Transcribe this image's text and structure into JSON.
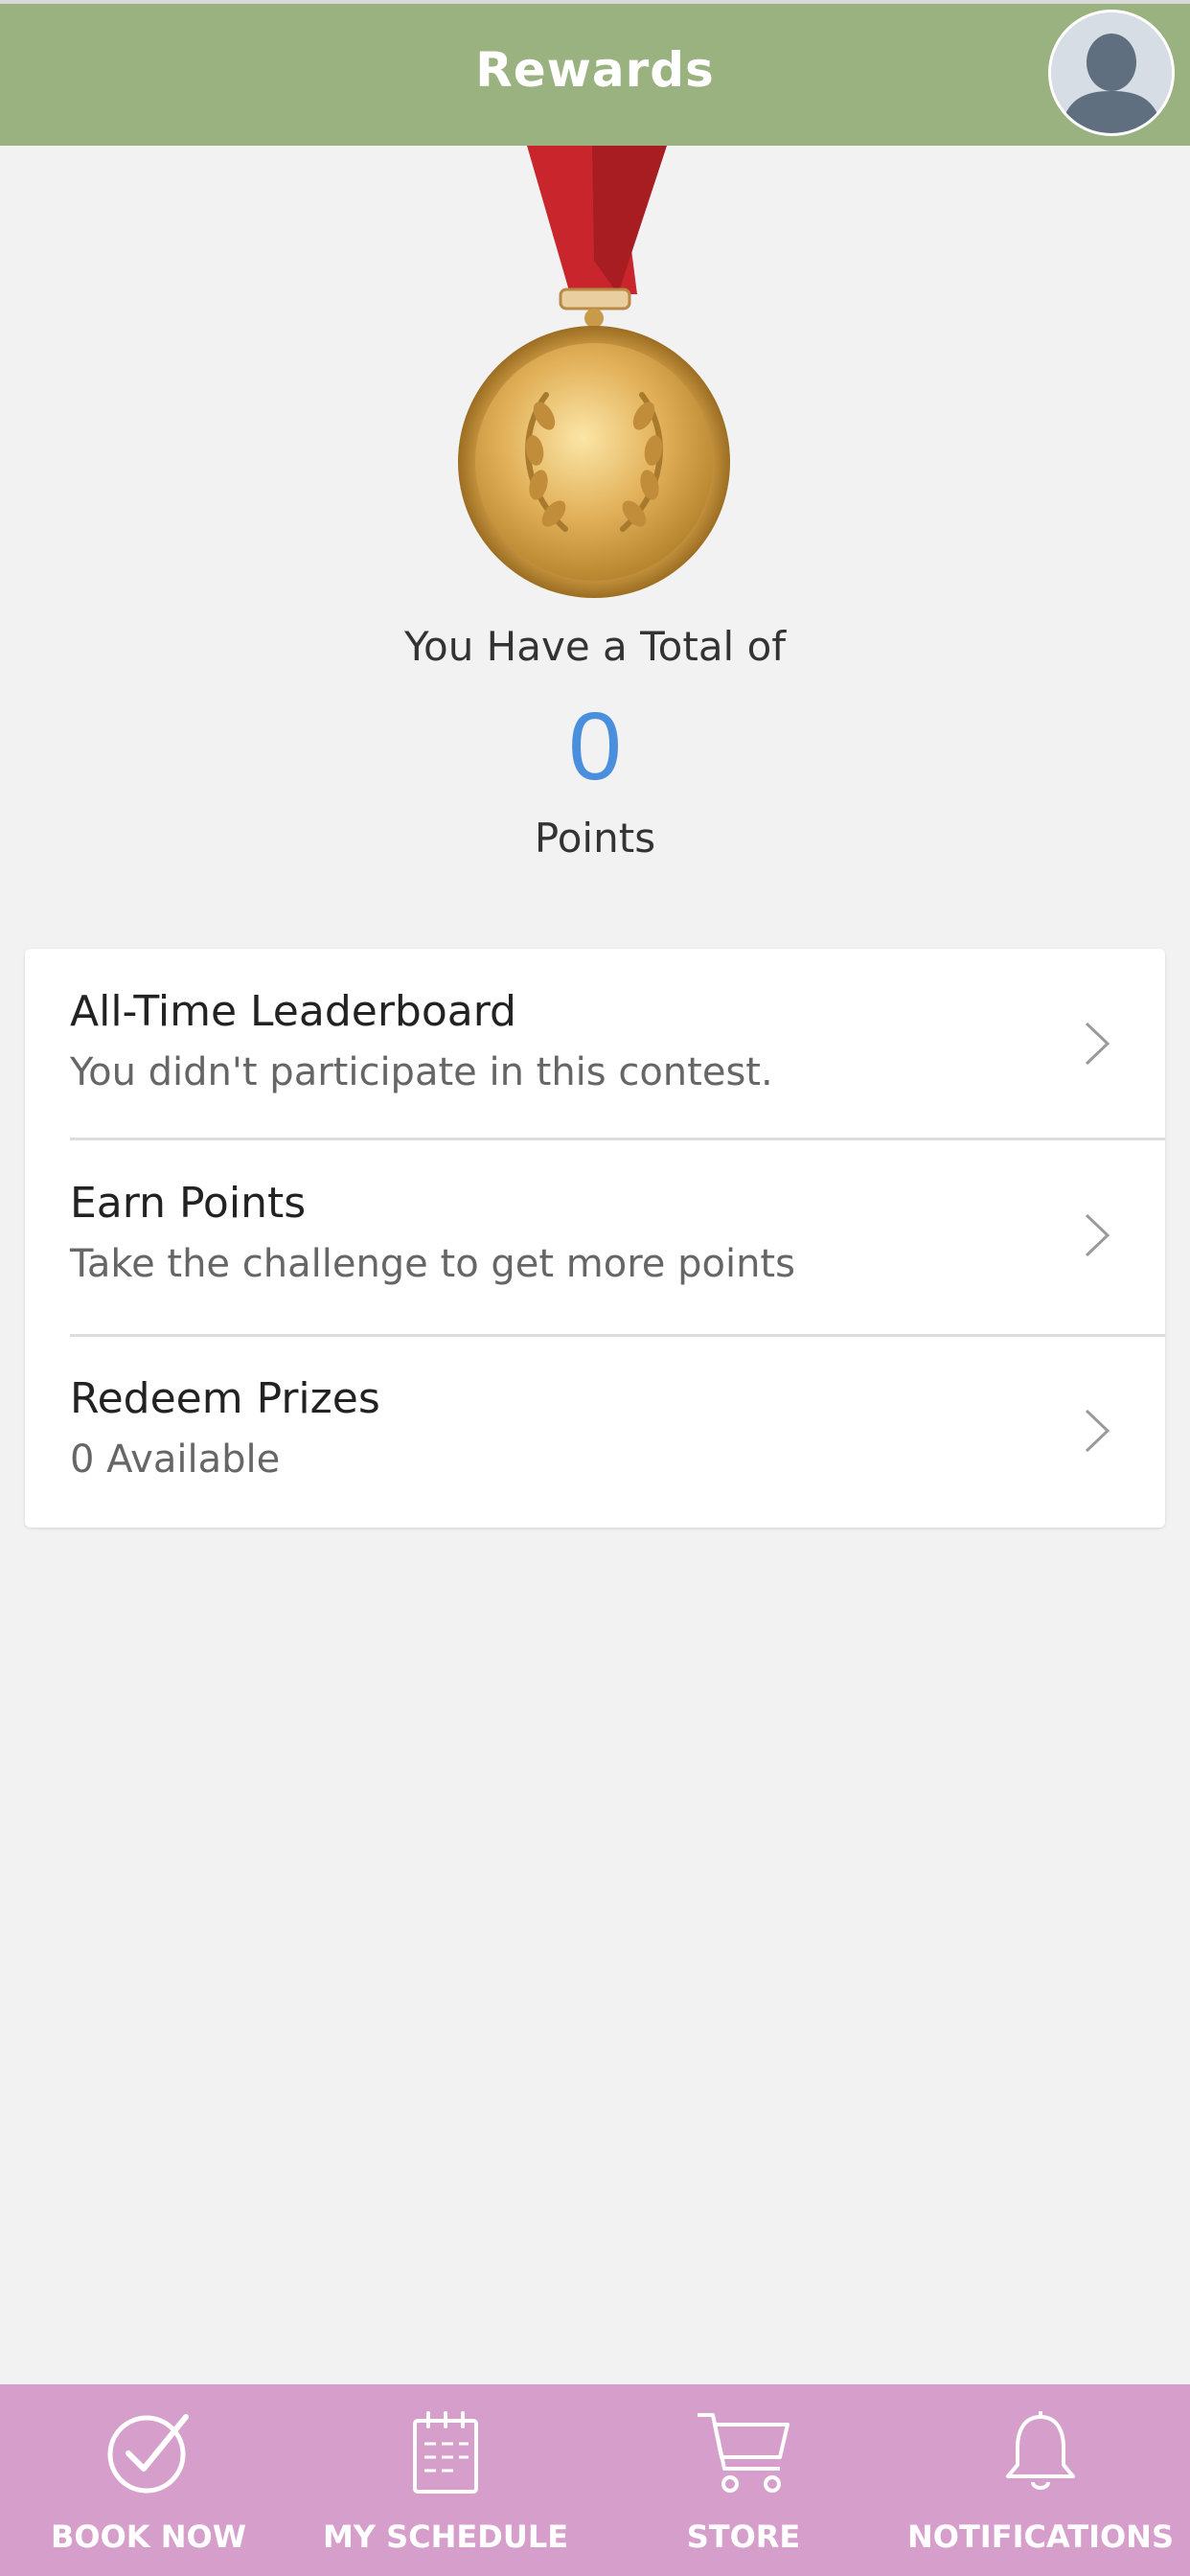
{
  "header": {
    "title": "Rewards",
    "avatar_icon": "user-avatar-icon"
  },
  "summary": {
    "total_label": "You Have a Total of",
    "points_value": "0",
    "points_label": "Points",
    "medal_icon": "gold-medal-icon"
  },
  "menu": {
    "items": [
      {
        "title": "All-Time Leaderboard",
        "subtitle": "You didn't participate in this contest."
      },
      {
        "title": "Earn Points",
        "subtitle": "Take the challenge to get more points"
      },
      {
        "title": "Redeem Prizes",
        "subtitle": "0 Available"
      }
    ]
  },
  "bottom_nav": {
    "items": [
      {
        "label": "BOOK NOW",
        "icon": "check-circle-icon"
      },
      {
        "label": "MY SCHEDULE",
        "icon": "calendar-icon"
      },
      {
        "label": "STORE",
        "icon": "cart-icon"
      },
      {
        "label": "NOTIFICATIONS",
        "icon": "bell-icon"
      }
    ]
  },
  "colors": {
    "header_bg": "#9ab27f",
    "page_bg": "#f2f2f2",
    "points_accent": "#4a8fdd",
    "nav_bg": "#d69fcb",
    "ribbon": "#c8262c",
    "medal_gold": "#e2b15a"
  }
}
